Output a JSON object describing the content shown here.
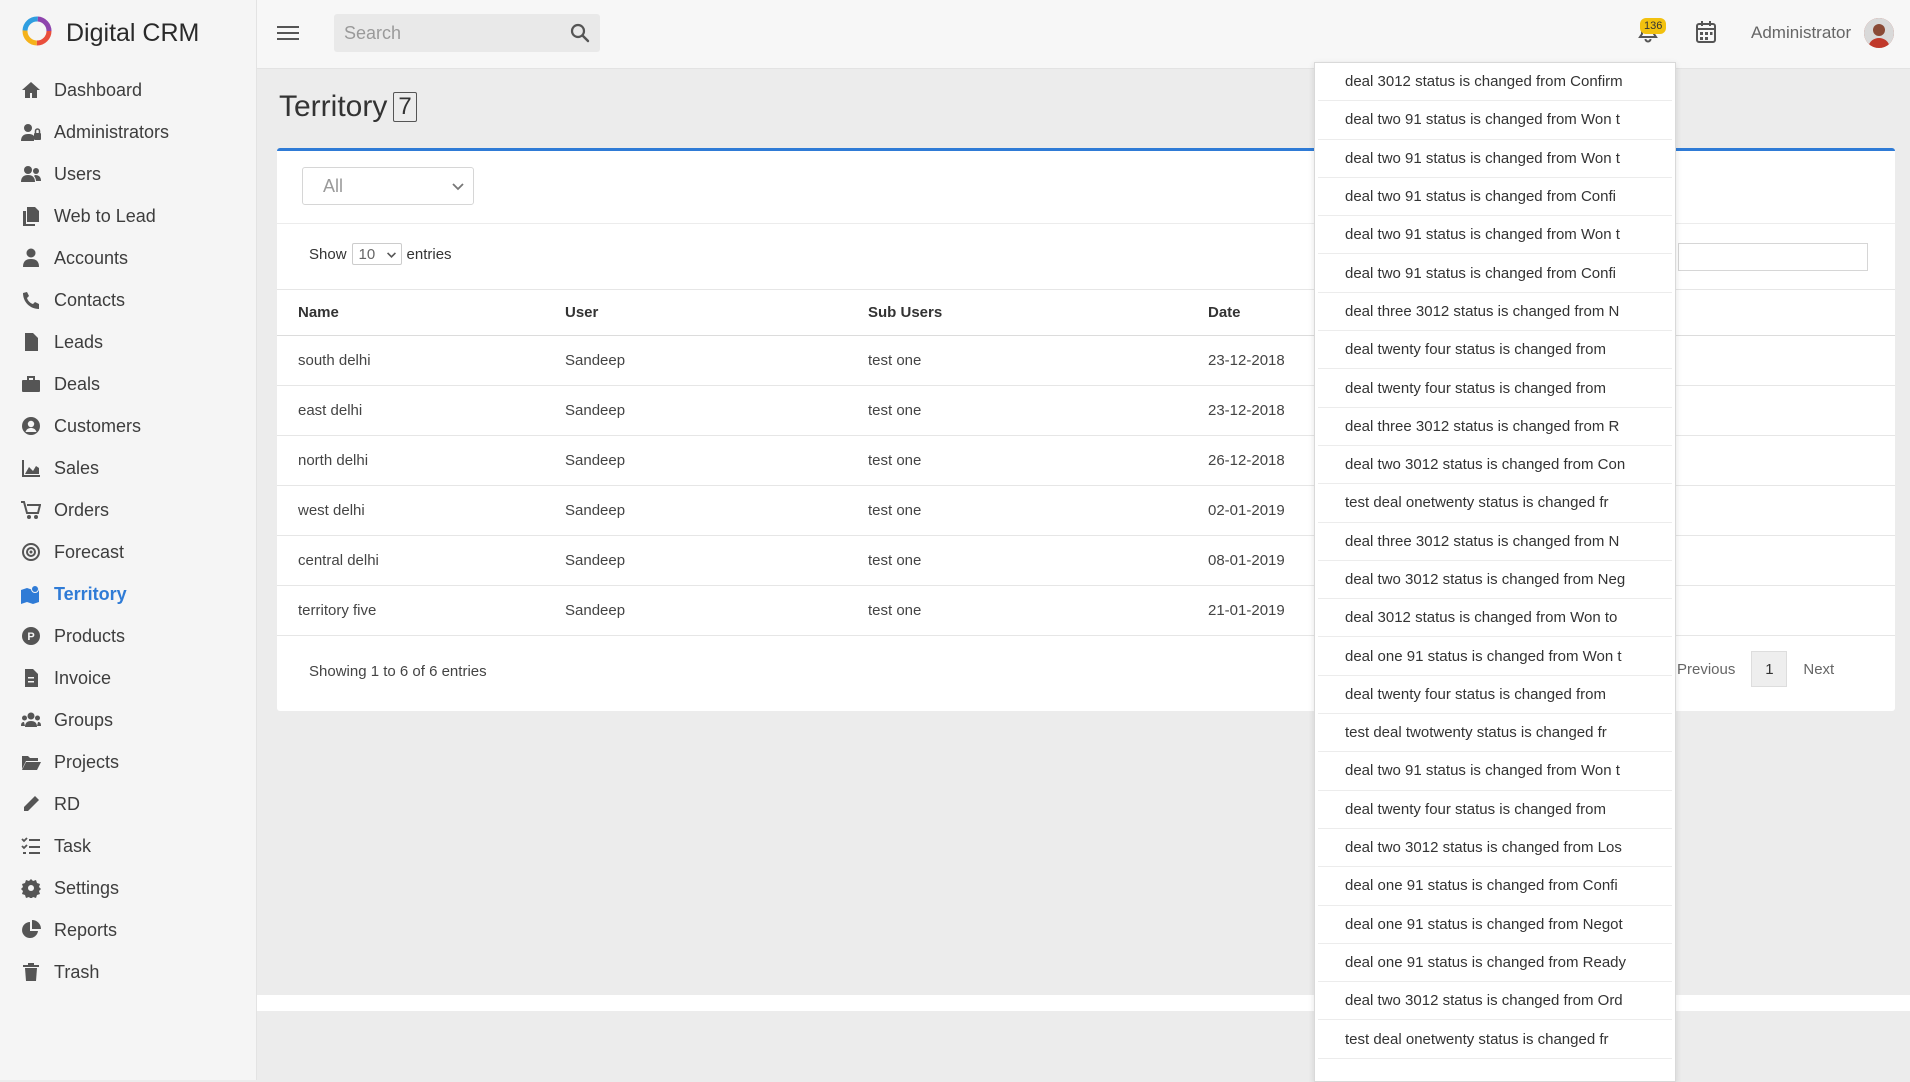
{
  "app": {
    "name": "Digital CRM"
  },
  "sidebar": {
    "items": [
      {
        "label": "Dashboard",
        "icon": "home-icon"
      },
      {
        "label": "Administrators",
        "icon": "user-lock-icon"
      },
      {
        "label": "Users",
        "icon": "users-icon"
      },
      {
        "label": "Web to Lead",
        "icon": "copy-icon"
      },
      {
        "label": "Accounts",
        "icon": "user-icon"
      },
      {
        "label": "Contacts",
        "icon": "phone-icon"
      },
      {
        "label": "Leads",
        "icon": "file-icon"
      },
      {
        "label": "Deals",
        "icon": "briefcase-icon"
      },
      {
        "label": "Customers",
        "icon": "user-circle-icon"
      },
      {
        "label": "Sales",
        "icon": "area-chart-icon"
      },
      {
        "label": "Orders",
        "icon": "cart-icon"
      },
      {
        "label": "Forecast",
        "icon": "target-icon"
      },
      {
        "label": "Territory",
        "icon": "map-marked-icon",
        "active": true
      },
      {
        "label": "Products",
        "icon": "product-icon"
      },
      {
        "label": "Invoice",
        "icon": "invoice-icon"
      },
      {
        "label": "Groups",
        "icon": "group-icon"
      },
      {
        "label": "Projects",
        "icon": "folder-open-icon"
      },
      {
        "label": "RD",
        "icon": "pencil-icon"
      },
      {
        "label": "Task",
        "icon": "tasks-icon"
      },
      {
        "label": "Settings",
        "icon": "gear-icon"
      },
      {
        "label": "Reports",
        "icon": "pie-chart-icon"
      },
      {
        "label": "Trash",
        "icon": "trash-icon"
      }
    ]
  },
  "topbar": {
    "search_placeholder": "Search",
    "notification_count": "136",
    "user_name": "Administrator"
  },
  "page": {
    "title": "Territory",
    "count": "7",
    "filter_value": "All",
    "show_label": "Show",
    "page_length": "10",
    "entries_label": "entries",
    "info": "Showing 1 to 6 of 6 entries",
    "prev_label": "Previous",
    "current_page": "1",
    "next_label": "Next"
  },
  "table": {
    "headers": [
      "Name",
      "User",
      "Sub Users",
      "Date"
    ],
    "rows": [
      [
        "south delhi",
        "Sandeep",
        "test one",
        "23-12-2018"
      ],
      [
        "east delhi",
        "Sandeep",
        "test one",
        "23-12-2018"
      ],
      [
        "north delhi",
        "Sandeep",
        "test one",
        "26-12-2018"
      ],
      [
        "west delhi",
        "Sandeep",
        "test one",
        "02-01-2019"
      ],
      [
        "central delhi",
        "Sandeep",
        "test one",
        "08-01-2019"
      ],
      [
        "territory five",
        "Sandeep",
        "test one",
        "21-01-2019"
      ]
    ]
  },
  "notifications": [
    "deal 3012 status is changed from Confirm",
    "deal two 91 status is changed from Won t",
    "deal two 91 status is changed from Won t",
    "deal two 91 status is changed from Confi",
    "deal two 91 status is changed from Won t",
    "deal two 91 status is changed from Confi",
    "deal three 3012 status is changed from N",
    "deal twenty four status is changed from",
    "deal twenty four status is changed from",
    "deal three 3012 status is changed from R",
    "deal two 3012 status is changed from Con",
    "test deal onetwenty status is changed fr",
    "deal three 3012 status is changed from N",
    "deal two 3012 status is changed from Neg",
    "deal 3012 status is changed from Won to",
    "deal one 91 status is changed from Won t",
    "deal twenty four status is changed from",
    "test deal twotwenty status is changed fr",
    "deal two 91 status is changed from Won t",
    "deal twenty four status is changed from",
    "deal two 3012 status is changed from Los",
    "deal one 91 status is changed from Confi",
    "deal one 91 status is changed from Negot",
    "deal one 91 status is changed from Ready",
    "deal two 3012 status is changed from Ord",
    "test deal onetwenty status is changed fr"
  ],
  "colors": {
    "accent": "#2f7bd6",
    "badge": "#f2c10f",
    "sidebar_bg": "#f5f5f5",
    "content_bg": "#ececec"
  }
}
